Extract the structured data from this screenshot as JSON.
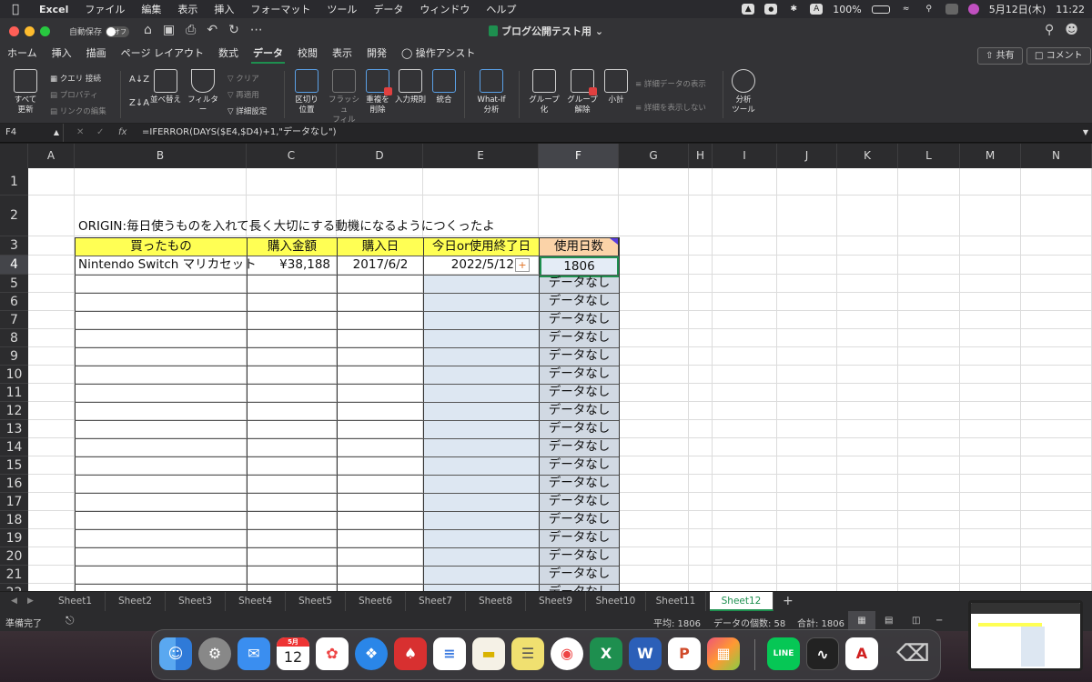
{
  "menubar": {
    "app": "Excel",
    "items": [
      "ファイル",
      "編集",
      "表示",
      "挿入",
      "フォーマット",
      "ツール",
      "データ",
      "ウィンドウ",
      "ヘルプ"
    ],
    "battery": "100%",
    "datetime": "5月12日(木)",
    "time": "11:22",
    "line_label": "LINE"
  },
  "titlebar": {
    "autosave_label": "自動保存",
    "autosave_state": "オフ",
    "doc_title": "ブログ公開テスト用"
  },
  "ribbon_tabs": [
    "ホーム",
    "挿入",
    "描画",
    "ページ レイアウト",
    "数式",
    "データ",
    "校閲",
    "表示",
    "開発"
  ],
  "active_tab": "データ",
  "assist_label": "操作アシスト",
  "share_label": "共有",
  "comment_label": "コメント",
  "ribbon": {
    "refresh_all": [
      "すべて",
      "更新"
    ],
    "query_conn": "クエリ 接続",
    "properties": "プロパティ",
    "edit_links": "リンクの編集",
    "sort": "並べ替え",
    "filter": "フィルター",
    "clear": "クリア",
    "reapply": "再適用",
    "advanced": "詳細設定",
    "text_to_columns": [
      "区切り",
      "位置"
    ],
    "flash_fill": [
      "フラッシュ",
      "フィル"
    ],
    "remove_dup": [
      "重複を",
      "削除"
    ],
    "validation": "入力規則",
    "consolidate": "統合",
    "whatif": [
      "What-If",
      "分析"
    ],
    "group": [
      "グループ",
      "化"
    ],
    "ungroup": [
      "グループ",
      "解除"
    ],
    "subtotal": "小計",
    "show_detail": "詳細データの表示",
    "hide_detail": "詳細を表示しない",
    "analysis_tools": [
      "分析",
      "ツール"
    ]
  },
  "formula_bar": {
    "name_box": "F4",
    "fx": "fx",
    "formula": "=IFERROR(DAYS($E4,$D4)+1,\"データなし\")"
  },
  "columns": [
    "A",
    "B",
    "C",
    "D",
    "E",
    "F",
    "G",
    "H",
    "I",
    "J",
    "K",
    "L",
    "M",
    "N"
  ],
  "rows": [
    "1",
    "2",
    "3",
    "4",
    "5",
    "6",
    "7",
    "8",
    "9",
    "10",
    "11",
    "12",
    "13",
    "14",
    "15",
    "16",
    "17",
    "18",
    "19",
    "20",
    "21",
    "22"
  ],
  "sheet": {
    "origin_text": "ORIGIN:毎日使うものを入れて長く大切にする動機になるようにつくったよ",
    "headers": [
      "買ったもの",
      "購入金額",
      "購入日",
      "今日or使用終了日",
      "使用日数"
    ],
    "row4": {
      "item": "Nintendo Switch マリカセット",
      "price": "¥38,188",
      "purchase_date": "2017/6/2",
      "end_date": "2022/5/12",
      "days": "1806"
    },
    "no_data": "データなし",
    "no_data_partial": "データなし"
  },
  "sheet_tabs": [
    "Sheet1",
    "Sheet2",
    "Sheet3",
    "Sheet4",
    "Sheet5",
    "Sheet6",
    "Sheet7",
    "Sheet8",
    "Sheet9",
    "Sheet10",
    "Sheet11",
    "Sheet12"
  ],
  "active_sheet": "Sheet12",
  "status": {
    "ready": "準備完了",
    "average": "平均: 1806",
    "count": "データの個数: 58",
    "sum": "合計: 1806"
  },
  "dock": {
    "calendar_month": "5月",
    "calendar_day": "12"
  },
  "colors": {
    "header_yellow": "#ffff54",
    "accent_green": "#1e8f4f",
    "fill_blue": "#dde7f2"
  }
}
